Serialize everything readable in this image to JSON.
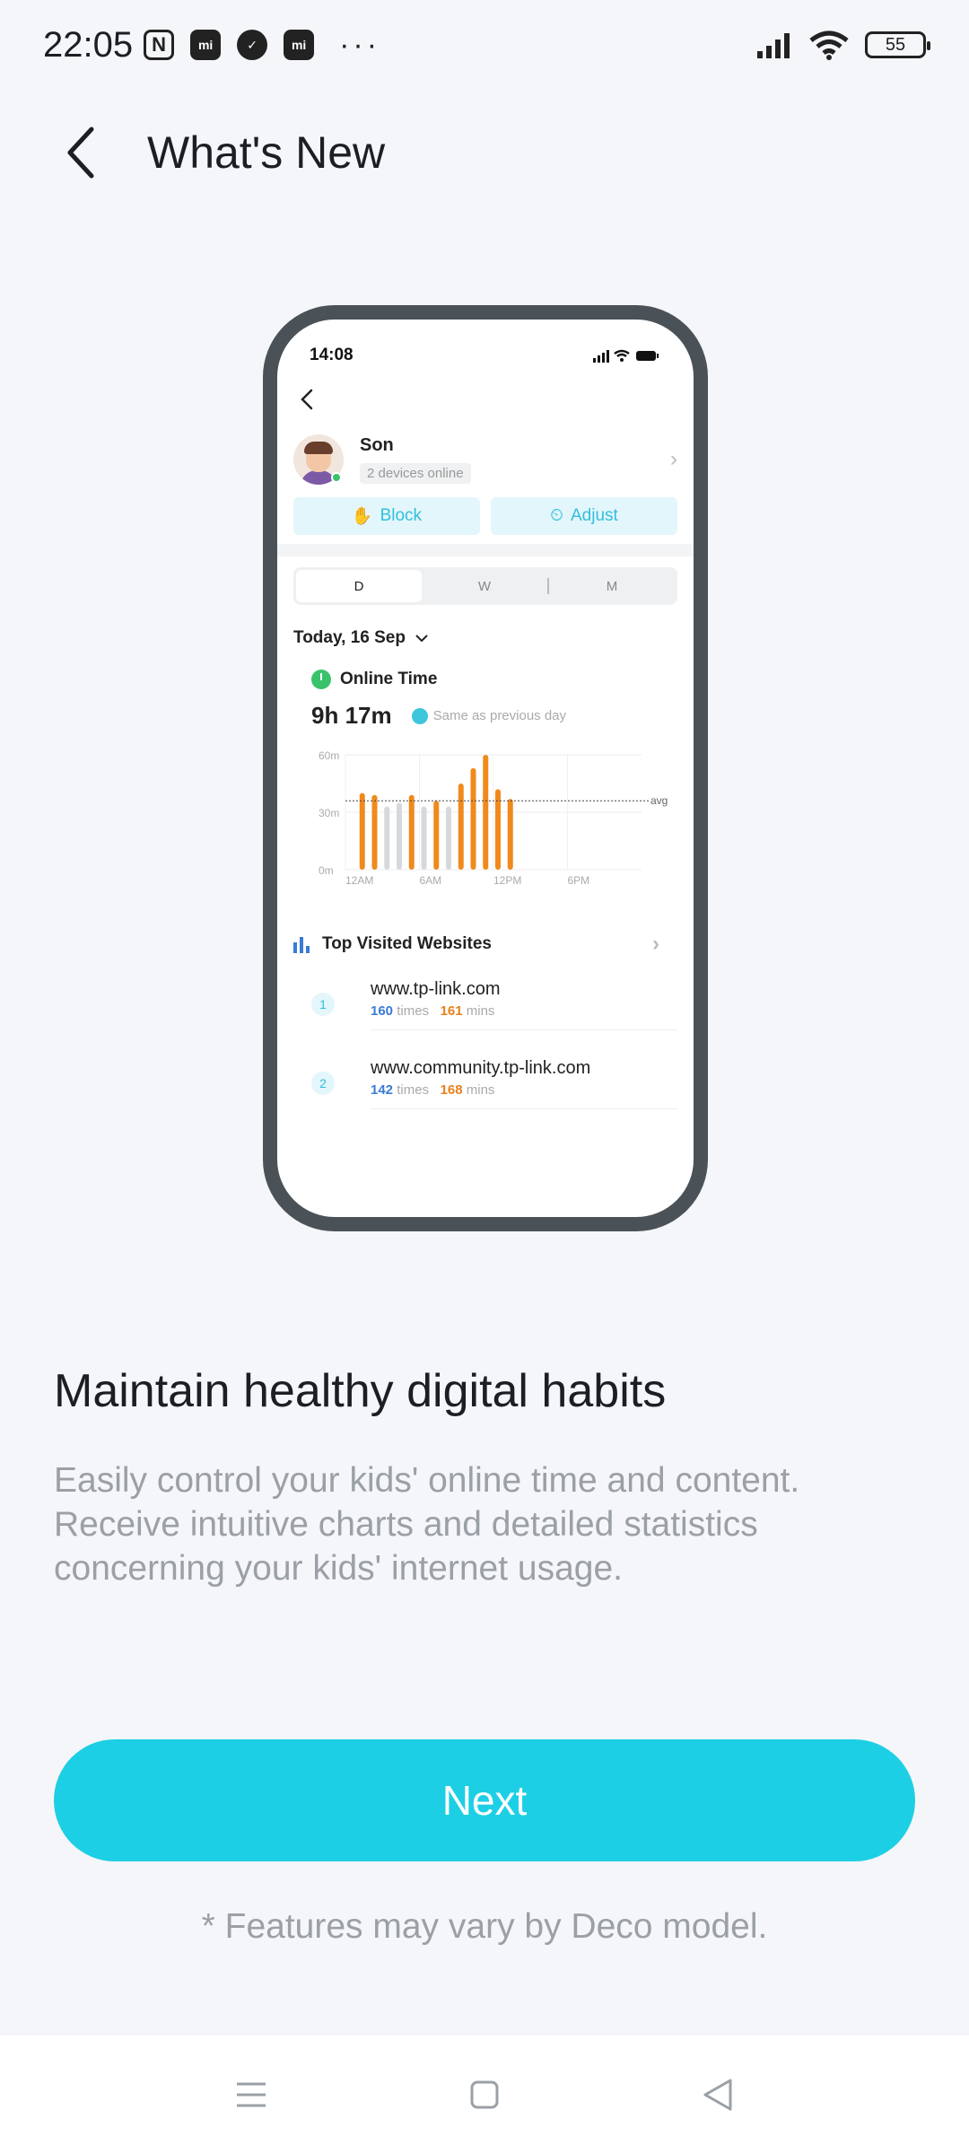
{
  "status_bar": {
    "time": "22:05",
    "battery": "55",
    "more": "···"
  },
  "header": {
    "title": "What's New"
  },
  "illustration": {
    "status_time": "14:08",
    "profile_name": "Son",
    "devices_online": "2 devices online",
    "block_label": "Block",
    "adjust_label": "Adjust",
    "segments": [
      "D",
      "W",
      "M"
    ],
    "date_label": "Today, 16 Sep",
    "online_time_title": "Online Time",
    "online_time_value": "9h 17m",
    "comparison": "Same as previous day",
    "top_sites_title": "Top Visited Websites",
    "sites": [
      {
        "rank": "1",
        "domain": "www.tp-link.com",
        "times": "160",
        "times_unit": "times",
        "mins": "161",
        "mins_unit": "mins"
      },
      {
        "rank": "2",
        "domain": "www.community.tp-link.com",
        "times": "142",
        "times_unit": "times",
        "mins": "168",
        "mins_unit": "mins"
      }
    ]
  },
  "chart_data": {
    "type": "bar",
    "ylabels": [
      "60m",
      "30m",
      "0m"
    ],
    "xlabels": [
      "12AM",
      "6AM",
      "12PM",
      "6PM"
    ],
    "avg_label": "avg",
    "avg_value": 36,
    "ylim": [
      0,
      60
    ],
    "bars": [
      {
        "hour": 1,
        "value": 40,
        "highlight": true
      },
      {
        "hour": 2,
        "value": 39,
        "highlight": true
      },
      {
        "hour": 3,
        "value": 33,
        "highlight": false
      },
      {
        "hour": 4,
        "value": 35,
        "highlight": false
      },
      {
        "hour": 5,
        "value": 39,
        "highlight": true
      },
      {
        "hour": 6,
        "value": 33,
        "highlight": false
      },
      {
        "hour": 7,
        "value": 36,
        "highlight": true
      },
      {
        "hour": 8,
        "value": 33,
        "highlight": false
      },
      {
        "hour": 9,
        "value": 45,
        "highlight": true
      },
      {
        "hour": 10,
        "value": 53,
        "highlight": true
      },
      {
        "hour": 11,
        "value": 60,
        "highlight": true
      },
      {
        "hour": 12,
        "value": 42,
        "highlight": true
      },
      {
        "hour": 13,
        "value": 37,
        "highlight": true
      }
    ],
    "colors": {
      "highlight": "#f08a1c",
      "normal": "#d6d9dc"
    }
  },
  "content": {
    "heading": "Maintain healthy digital habits",
    "description": "Easily control your kids' online time and content. Receive intuitive charts and detailed statistics concerning your kids' internet usage.",
    "next_label": "Next",
    "footnote": "* Features may vary by Deco model."
  },
  "theme": {
    "accent": "#1dcfe4"
  }
}
